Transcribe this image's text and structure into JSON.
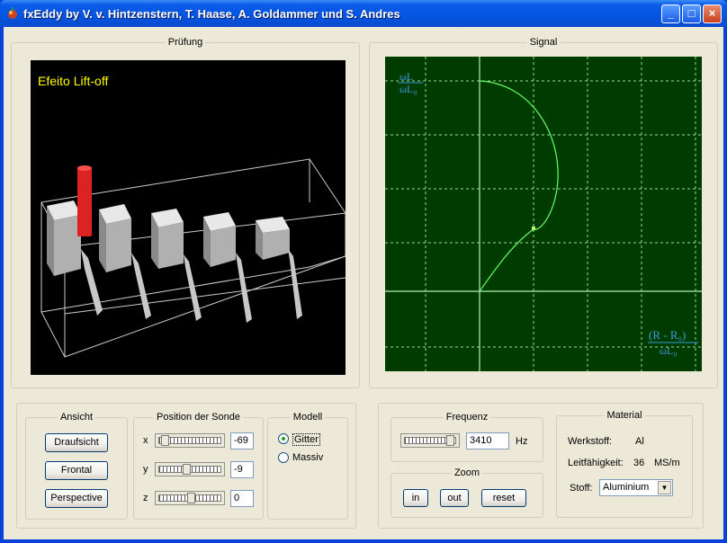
{
  "window": {
    "title": "fxEddy by V. v. Hintzenstern, T. Haase,  A. Goldammer und S. Andres",
    "minimize": "_",
    "maximize": "□",
    "close": "×",
    "icon": "app-icon"
  },
  "pruefung": {
    "label": "Prüfung",
    "scene_title": "Efeito Lift-off",
    "scene_title_color": "#ffff00",
    "probe_color": "#dd2222"
  },
  "signal": {
    "label": "Signal",
    "y_axis_label_num": "ωL",
    "y_axis_label_den": "ωL₀",
    "x_axis_label_num": "(R - R₀)",
    "x_axis_label_den": "ωL₀",
    "curve_color": "#66ff66"
  },
  "ansicht": {
    "label": "Ansicht",
    "draufsicht": "Draufsicht",
    "frontal": "Frontal",
    "perspective": "Perspective"
  },
  "position": {
    "label": "Position der Sonde",
    "x_label": "x",
    "x_value": "-69",
    "y_label": "y",
    "y_value": "-9",
    "z_label": "z",
    "z_value": "0"
  },
  "modell": {
    "label": "Modell",
    "gitter": "Gitter",
    "massiv": "Massiv",
    "selected": "Gitter"
  },
  "frequenz": {
    "label": "Frequenz",
    "value": "3410",
    "unit": "Hz"
  },
  "zoom": {
    "label": "Zoom",
    "in": "in",
    "out": "out",
    "reset": "reset"
  },
  "material": {
    "label": "Material",
    "werkstoff_label": "Werkstoff:",
    "werkstoff_value": "Al",
    "leitf_label": "Leitfähigkeit:",
    "leitf_value": "36",
    "leitf_unit": "MS/m",
    "stoff_label": "Stoff:",
    "stoff_value": "Aluminium"
  }
}
